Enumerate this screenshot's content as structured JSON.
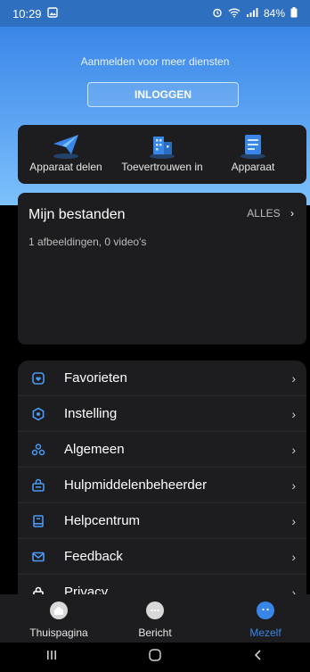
{
  "status": {
    "time": "10:29",
    "battery": "84%"
  },
  "header": {
    "prompt": "Aanmelden voor meer diensten",
    "login_label": "INLOGGEN"
  },
  "quick_actions": [
    {
      "label": "Apparaat delen",
      "icon": "paper-plane-icon"
    },
    {
      "label": "Toevertrouwen in",
      "icon": "building-icon"
    },
    {
      "label": "Apparaat",
      "icon": "document-icon"
    }
  ],
  "files": {
    "title": "Mijn bestanden",
    "all_label": "ALLES",
    "summary": "1 afbeeldingen, 0 video's"
  },
  "menu": [
    {
      "label": "Favorieten",
      "icon": "favorites-icon"
    },
    {
      "label": "Instelling",
      "icon": "settings-icon"
    },
    {
      "label": "Algemeen",
      "icon": "general-icon"
    },
    {
      "label": "Hulpmiddelenbeheerder",
      "icon": "tools-icon"
    },
    {
      "label": "Helpcentrum",
      "icon": "help-icon"
    },
    {
      "label": "Feedback",
      "icon": "mail-icon"
    },
    {
      "label": "Privacy",
      "icon": "lock-icon"
    }
  ],
  "nav": [
    {
      "label": "Thuispagina"
    },
    {
      "label": "Bericht"
    },
    {
      "label": "Mezelf"
    }
  ],
  "colors": {
    "accent": "#3a86e8",
    "card": "#1d1d1f",
    "background": "#000000"
  }
}
